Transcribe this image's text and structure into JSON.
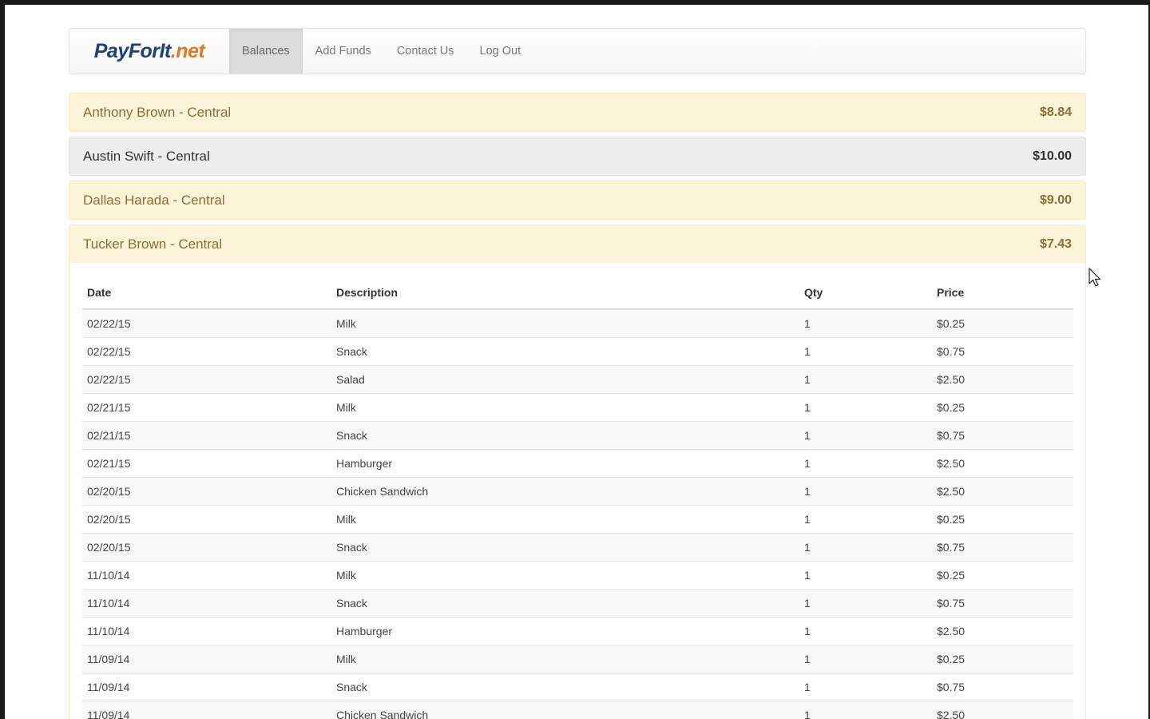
{
  "brand": {
    "part1": "PayForIt",
    "part2": ".net"
  },
  "nav": [
    {
      "label": "Balances"
    },
    {
      "label": "Add Funds"
    },
    {
      "label": "Contact Us"
    },
    {
      "label": "Log Out"
    }
  ],
  "accounts": [
    {
      "name": "Anthony Brown - Central",
      "balance": "$8.84"
    },
    {
      "name": "Austin Swift - Central",
      "balance": "$10.00"
    },
    {
      "name": "Dallas Harada - Central",
      "balance": "$9.00"
    },
    {
      "name": "Tucker Brown - Central",
      "balance": "$7.43"
    }
  ],
  "table": {
    "headers": {
      "date": "Date",
      "description": "Description",
      "qty": "Qty",
      "price": "Price"
    },
    "rows": [
      {
        "date": "02/22/15",
        "description": "Milk",
        "qty": "1",
        "price": "$0.25"
      },
      {
        "date": "02/22/15",
        "description": "Snack",
        "qty": "1",
        "price": "$0.75"
      },
      {
        "date": "02/22/15",
        "description": "Salad",
        "qty": "1",
        "price": "$2.50"
      },
      {
        "date": "02/21/15",
        "description": "Milk",
        "qty": "1",
        "price": "$0.25"
      },
      {
        "date": "02/21/15",
        "description": "Snack",
        "qty": "1",
        "price": "$0.75"
      },
      {
        "date": "02/21/15",
        "description": "Hamburger",
        "qty": "1",
        "price": "$2.50"
      },
      {
        "date": "02/20/15",
        "description": "Chicken Sandwich",
        "qty": "1",
        "price": "$2.50"
      },
      {
        "date": "02/20/15",
        "description": "Milk",
        "qty": "1",
        "price": "$0.25"
      },
      {
        "date": "02/20/15",
        "description": "Snack",
        "qty": "1",
        "price": "$0.75"
      },
      {
        "date": "11/10/14",
        "description": "Milk",
        "qty": "1",
        "price": "$0.25"
      },
      {
        "date": "11/10/14",
        "description": "Snack",
        "qty": "1",
        "price": "$0.75"
      },
      {
        "date": "11/10/14",
        "description": "Hamburger",
        "qty": "1",
        "price": "$2.50"
      },
      {
        "date": "11/09/14",
        "description": "Milk",
        "qty": "1",
        "price": "$0.25"
      },
      {
        "date": "11/09/14",
        "description": "Snack",
        "qty": "1",
        "price": "$0.75"
      },
      {
        "date": "11/09/14",
        "description": "Chicken Sandwich",
        "qty": "1",
        "price": "$2.50"
      }
    ]
  },
  "colors": {
    "brand_blue": "#1f3f7a",
    "brand_orange": "#e07a1c",
    "warning_bg": "#fcf4d9",
    "default_bg": "#ededed"
  },
  "icons": {
    "cursor": "mouse-pointer-icon"
  }
}
